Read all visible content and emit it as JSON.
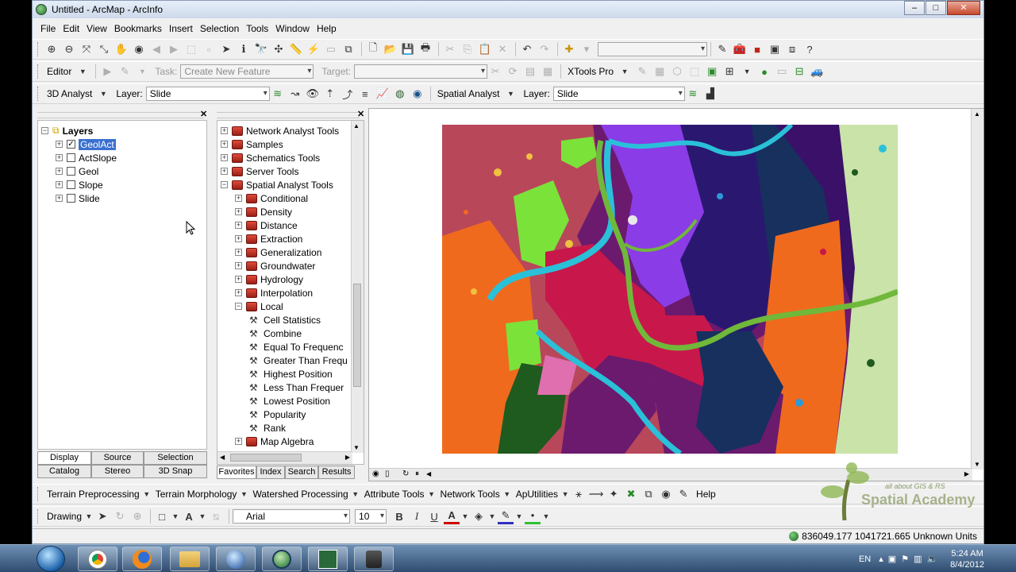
{
  "window": {
    "title": "Untitled - ArcMap - ArcInfo"
  },
  "menu": [
    "File",
    "Edit",
    "View",
    "Bookmarks",
    "Insert",
    "Selection",
    "Tools",
    "Window",
    "Help"
  ],
  "editor_toolbar": {
    "editor_label": "Editor",
    "task_label": "Task:",
    "task_value": "Create New Feature",
    "target_label": "Target:",
    "xtools_label": "XTools Pro"
  },
  "analyst_toolbar": {
    "analyst3d_label": "3D Analyst",
    "layer_label": "Layer:",
    "layer_value": "Slide",
    "spatial_label": "Spatial Analyst",
    "layer2_label": "Layer:",
    "layer2_value": "Slide"
  },
  "toc": {
    "root": "Layers",
    "layers": [
      {
        "name": "GeolAct",
        "checked": true,
        "selected": true
      },
      {
        "name": "ActSlope",
        "checked": false
      },
      {
        "name": "Geol",
        "checked": false
      },
      {
        "name": "Slope",
        "checked": false
      },
      {
        "name": "Slide",
        "checked": false
      }
    ],
    "tabs_top": [
      "Display",
      "Source",
      "Selection"
    ],
    "tabs_bottom": [
      "Catalog",
      "Stereo",
      "3D Snap"
    ]
  },
  "toolbox": {
    "items": [
      {
        "label": "Network Analyst Tools",
        "level": 0,
        "type": "toolbox",
        "exp": "+"
      },
      {
        "label": "Samples",
        "level": 0,
        "type": "toolbox",
        "exp": "+"
      },
      {
        "label": "Schematics Tools",
        "level": 0,
        "type": "toolbox",
        "exp": "+"
      },
      {
        "label": "Server Tools",
        "level": 0,
        "type": "toolbox",
        "exp": "+"
      },
      {
        "label": "Spatial Analyst Tools",
        "level": 0,
        "type": "toolbox",
        "exp": "−"
      },
      {
        "label": "Conditional",
        "level": 1,
        "type": "toolbox",
        "exp": "+"
      },
      {
        "label": "Density",
        "level": 1,
        "type": "toolbox",
        "exp": "+"
      },
      {
        "label": "Distance",
        "level": 1,
        "type": "toolbox",
        "exp": "+"
      },
      {
        "label": "Extraction",
        "level": 1,
        "type": "toolbox",
        "exp": "+"
      },
      {
        "label": "Generalization",
        "level": 1,
        "type": "toolbox",
        "exp": "+"
      },
      {
        "label": "Groundwater",
        "level": 1,
        "type": "toolbox",
        "exp": "+"
      },
      {
        "label": "Hydrology",
        "level": 1,
        "type": "toolbox",
        "exp": "+"
      },
      {
        "label": "Interpolation",
        "level": 1,
        "type": "toolbox",
        "exp": "+"
      },
      {
        "label": "Local",
        "level": 1,
        "type": "toolbox",
        "exp": "−"
      },
      {
        "label": "Cell Statistics",
        "level": 2,
        "type": "tool"
      },
      {
        "label": "Combine",
        "level": 2,
        "type": "tool"
      },
      {
        "label": "Equal To Frequenc",
        "level": 2,
        "type": "tool"
      },
      {
        "label": "Greater Than Frequ",
        "level": 2,
        "type": "tool"
      },
      {
        "label": "Highest Position",
        "level": 2,
        "type": "tool"
      },
      {
        "label": "Less Than Frequer",
        "level": 2,
        "type": "tool"
      },
      {
        "label": "Lowest Position",
        "level": 2,
        "type": "tool"
      },
      {
        "label": "Popularity",
        "level": 2,
        "type": "tool"
      },
      {
        "label": "Rank",
        "level": 2,
        "type": "tool"
      },
      {
        "label": "Map Algebra",
        "level": 1,
        "type": "toolbox",
        "exp": "+"
      }
    ],
    "tabs": [
      "Favorites",
      "Index",
      "Search",
      "Results"
    ]
  },
  "bottom_toolbar": {
    "items": [
      "Terrain Preprocessing",
      "Terrain Morphology",
      "Watershed Processing",
      "Attribute Tools",
      "Network Tools",
      "ApUtilities"
    ],
    "help": "Help"
  },
  "drawing_toolbar": {
    "drawing_label": "Drawing",
    "font": "Arial",
    "size": "10",
    "bold": "B",
    "italic": "I",
    "underline": "U",
    "font_color": "A"
  },
  "status": {
    "coords": "836049.177  1041721.665 Unknown Units"
  },
  "watermark": {
    "line1": "all about GIS & RS",
    "line2": "Spatial Academy"
  },
  "taskbar": {
    "lang": "EN",
    "time": "5:24 AM",
    "date": "8/4/2012"
  },
  "colors": {
    "selection": "#3a70d0",
    "toolbox_red": "#c0271a",
    "taskbar": "#3b5a82"
  }
}
